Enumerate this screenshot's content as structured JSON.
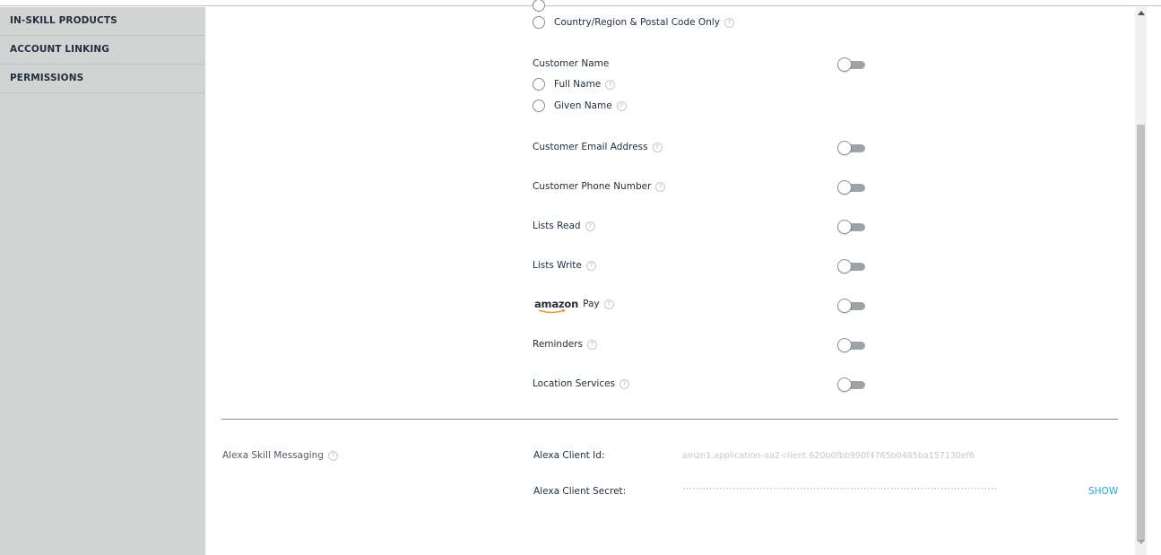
{
  "sidebar": {
    "items": [
      {
        "label": "IN-SKILL PRODUCTS"
      },
      {
        "label": "ACCOUNT LINKING"
      },
      {
        "label": "PERMISSIONS"
      }
    ]
  },
  "permissions": {
    "address_option_postal": "Country/Region & Postal Code Only",
    "customer_name": {
      "label": "Customer Name",
      "full_name": "Full Name",
      "given_name": "Given Name"
    },
    "email": "Customer Email Address",
    "phone": "Customer Phone Number",
    "lists_read": "Lists Read",
    "lists_write": "Lists Write",
    "amazon_pay": {
      "brand": "amazon",
      "label": "Pay"
    },
    "reminders": "Reminders",
    "location_services": "Location Services"
  },
  "messaging": {
    "section_label": "Alexa Skill Messaging",
    "client_id_label": "Alexa Client Id:",
    "client_id_value": "amzn1.application-oa2-client.620b0fbb990f4765b0485ba157130ef6",
    "client_secret_label": "Alexa Client Secret:",
    "client_secret_value": "••••••••••••••••••••••••••••••••••••••••••••••••••••••••••••••••••••••••••••••••••••••••••••••",
    "show_label": "SHOW"
  },
  "help_glyph": "?",
  "colors": {
    "sidebar_bg": "#d2d4d4",
    "toggle_track": "#9da3a8",
    "link": "#27a4d8"
  }
}
